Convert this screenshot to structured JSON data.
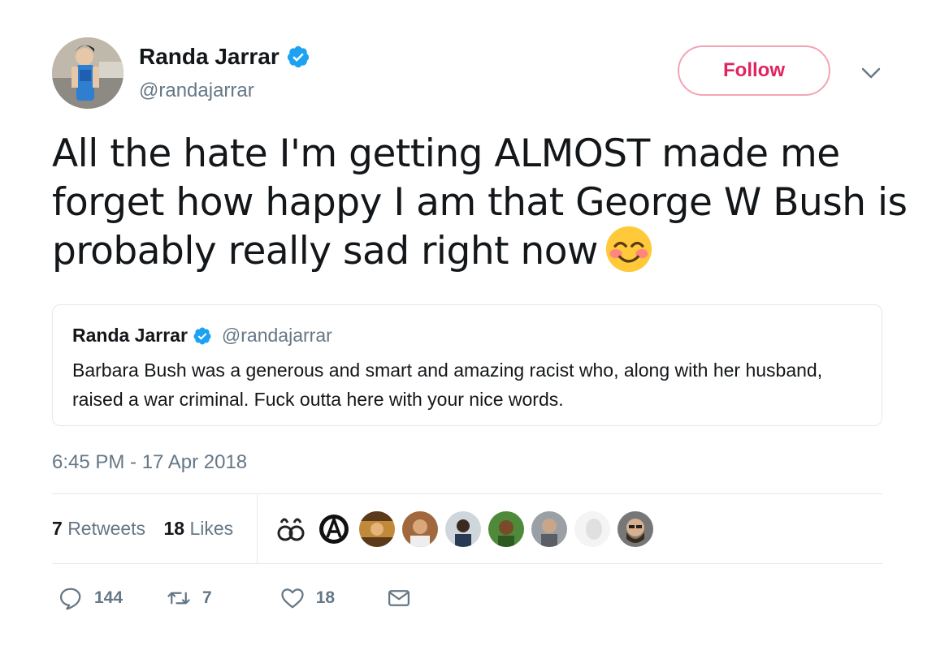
{
  "author": {
    "name": "Randa Jarrar",
    "handle": "@randajarrar",
    "verified": true
  },
  "follow_label": "Follow",
  "tweet": {
    "text": "All the hate I'm getting ALMOST made me forget how happy I am that George W Bush is probably really sad right now",
    "emoji": "smiling-face-with-smiling-eyes-icon"
  },
  "quoted_tweet": {
    "name": "Randa Jarrar",
    "handle": "@randajarrar",
    "text": "Barbara Bush was a generous and smart and amazing racist who, along with her husband, raised a war criminal. Fuck outta here with your nice words."
  },
  "timestamp": "6:45 PM - 17 Apr 2018",
  "stats": {
    "retweets_count": "7",
    "retweets_label": "Retweets",
    "likes_count": "18",
    "likes_label": "Likes"
  },
  "liker_avatars": 10,
  "actions": {
    "replies": "144",
    "retweets": "7",
    "likes": "18"
  },
  "colors": {
    "accent_pink": "#e0245e",
    "verified_blue": "#1da1f2",
    "muted_text": "#657786",
    "border": "#e1e8ed"
  }
}
